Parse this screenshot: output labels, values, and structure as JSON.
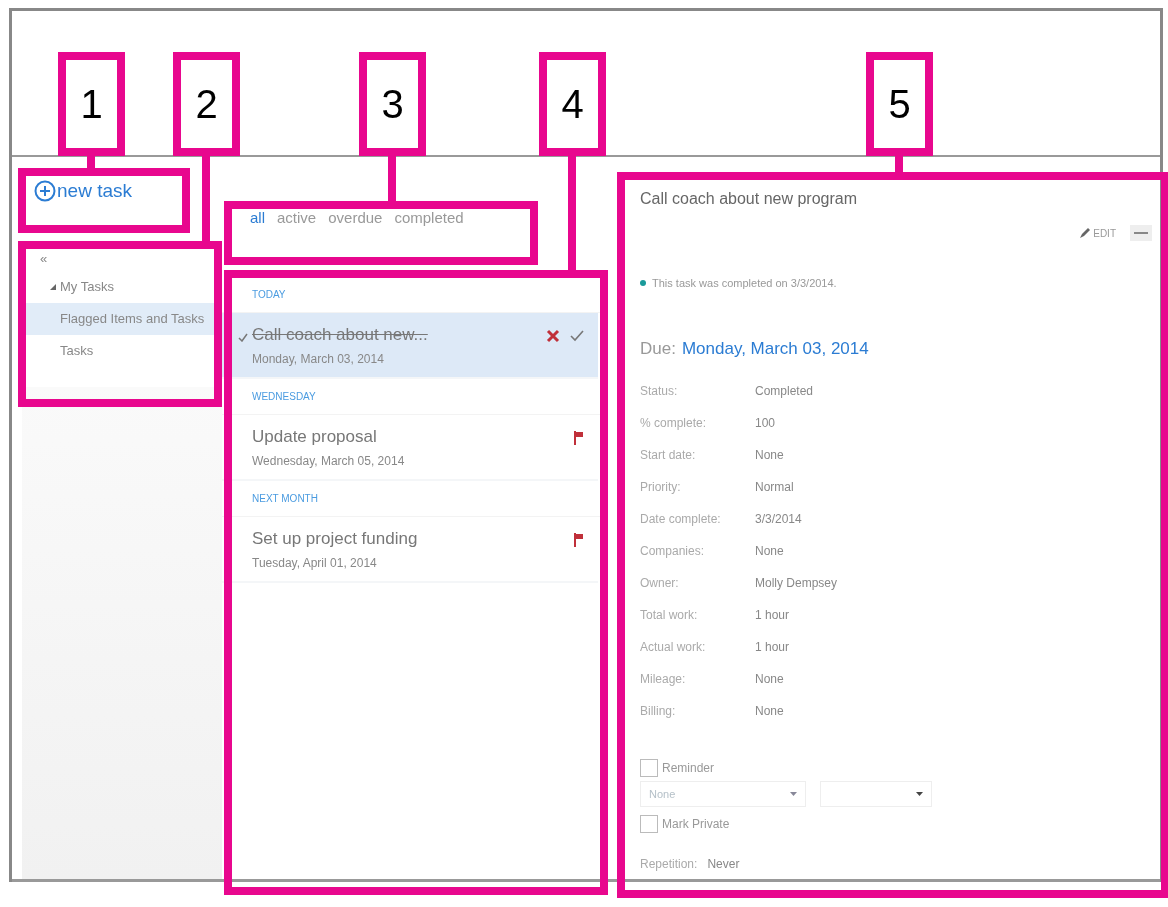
{
  "callouts": [
    {
      "number": "1"
    },
    {
      "number": "2"
    },
    {
      "number": "3"
    },
    {
      "number": "4"
    },
    {
      "number": "5"
    }
  ],
  "new_task_button": {
    "label": "new task"
  },
  "folders": {
    "collapse": "«",
    "items": [
      {
        "label": "My Tasks",
        "expanded": true,
        "selected": false,
        "children": [
          {
            "label": "Flagged Items and Tasks",
            "selected": true
          },
          {
            "label": "Tasks",
            "selected": false
          }
        ]
      }
    ]
  },
  "filters": [
    {
      "label": "all",
      "selected": true
    },
    {
      "label": "active",
      "selected": false
    },
    {
      "label": "overdue",
      "selected": false
    },
    {
      "label": "completed",
      "selected": false
    }
  ],
  "task_groups": [
    {
      "heading": "TODAY",
      "tasks": [
        {
          "title": "Call coach about new...",
          "date": "Monday, March 03, 2014",
          "selected": true,
          "completed": true,
          "flagged": false
        }
      ]
    },
    {
      "heading": "WEDNESDAY",
      "tasks": [
        {
          "title": "Update proposal",
          "date": "Wednesday, March 05, 2014",
          "selected": false,
          "completed": false,
          "flagged": true
        }
      ]
    },
    {
      "heading": "NEXT MONTH",
      "tasks": [
        {
          "title": "Set up project funding",
          "date": "Tuesday, April 01, 2014",
          "selected": false,
          "completed": false,
          "flagged": true
        }
      ]
    }
  ],
  "detail": {
    "title": "Call coach about new program",
    "edit_label": "EDIT",
    "info": "This task was completed on 3/3/2014.",
    "due_label": "Due:",
    "due_value": "Monday, March 03, 2014",
    "fields": [
      {
        "label": "Status:",
        "value": "Completed"
      },
      {
        "label": "% complete:",
        "value": "100"
      },
      {
        "label": "Start date:",
        "value": "None"
      },
      {
        "label": "Priority:",
        "value": "Normal"
      },
      {
        "label": "Date complete:",
        "value": "3/3/2014"
      },
      {
        "label": "Companies:",
        "value": "None"
      },
      {
        "label": "Owner:",
        "value": "Molly Dempsey"
      },
      {
        "label": "Total work:",
        "value": "1 hour"
      },
      {
        "label": "Actual work:",
        "value": "1 hour"
      },
      {
        "label": "Mileage:",
        "value": "None"
      },
      {
        "label": "Billing:",
        "value": "None"
      }
    ],
    "reminder": {
      "label": "Reminder",
      "checked": false
    },
    "reminder_date": {
      "placeholder": "None"
    },
    "mark_private": {
      "label": "Mark Private",
      "checked": false
    },
    "repetition": {
      "label": "Repetition:",
      "value": "Never"
    }
  }
}
